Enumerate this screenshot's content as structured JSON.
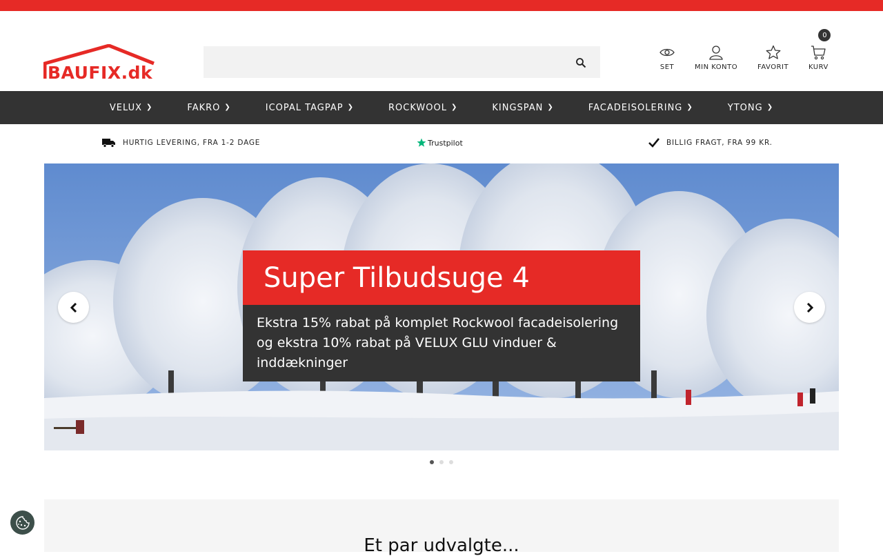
{
  "brand": {
    "accent": "#e62a26",
    "dark": "#333333"
  },
  "logo": {
    "text": "BAUFIX.dk"
  },
  "search": {
    "placeholder": "",
    "value": ""
  },
  "header_icons": {
    "set": {
      "label": "SET",
      "icon": "eye-icon"
    },
    "account": {
      "label": "MIN KONTO",
      "icon": "user-icon"
    },
    "favorite": {
      "label": "FAVORIT",
      "icon": "star-icon"
    },
    "cart": {
      "label": "KURV",
      "icon": "cart-icon",
      "count": "0"
    }
  },
  "nav": {
    "items": [
      {
        "label": "VELUX"
      },
      {
        "label": "FAKRO"
      },
      {
        "label": "ICOPAL TAGPAP"
      },
      {
        "label": "ROCKWOOL"
      },
      {
        "label": "KINGSPAN"
      },
      {
        "label": "FACADEISOLERING"
      },
      {
        "label": "YTONG"
      }
    ]
  },
  "usp": {
    "delivery": "HURTIG LEVERING, FRA 1-2 DAGE",
    "trustpilot": "Trustpilot",
    "shipping": "BILLIG FRAGT, FRA 99 KR."
  },
  "hero": {
    "title": "Super Tilbudsuge 4",
    "text": "Ekstra 15% rabat på komplet Rockwool facadeisolering og ekstra 10% rabat på VELUX GLU vinduer & inddækninger",
    "slides": 3,
    "active_slide": 1
  },
  "section": {
    "heading": "Et par udvalgte..."
  }
}
